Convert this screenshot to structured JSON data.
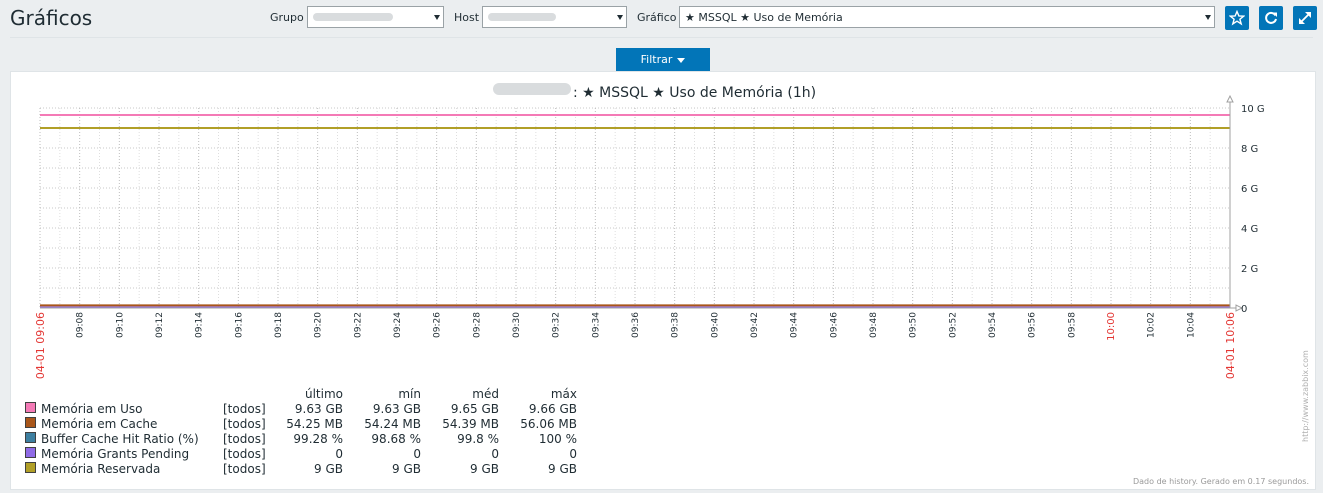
{
  "header": {
    "title": "Gráficos",
    "group_label": "Grupo",
    "host_label": "Host",
    "graph_label": "Gráfico",
    "graph_value": "★ MSSQL ★ Uso de Memória"
  },
  "toolbar": {
    "favorite_icon": "star-icon",
    "refresh_icon": "refresh-icon",
    "fullscreen_icon": "fullscreen-icon"
  },
  "filter": {
    "label": "Filtrar"
  },
  "colors": {
    "accent": "#0275b8"
  },
  "chart_data": {
    "type": "line",
    "title": ": ★ MSSQL ★ Uso de Memória (1h)",
    "y_ticks": [
      "10 G",
      "8 G",
      "6 G",
      "4 G",
      "2 G",
      "0"
    ],
    "ylim": [
      0,
      10
    ],
    "y_unit": "G",
    "x_start_label": "04-01 09:06",
    "x_end_label": "04-01 10:06",
    "x_ticks": [
      "09:08",
      "09:10",
      "09:12",
      "09:14",
      "09:16",
      "09:18",
      "09:20",
      "09:22",
      "09:24",
      "09:26",
      "09:28",
      "09:30",
      "09:32",
      "09:34",
      "09:36",
      "09:38",
      "09:40",
      "09:42",
      "09:44",
      "09:46",
      "09:48",
      "09:50",
      "09:52",
      "09:54",
      "09:56",
      "09:58",
      "10:00",
      "10:02",
      "10:04"
    ],
    "x_red_ticks": [
      "10:00"
    ],
    "grid": true,
    "legend_headers": {
      "last": "último",
      "min": "mín",
      "avg": "méd",
      "max": "máx"
    },
    "series": [
      {
        "name": "Memória em Uso",
        "color": "#f47ab6",
        "func": "[todos]",
        "last": "9.63 GB",
        "min": "9.63 GB",
        "avg": "9.65 GB",
        "max": "9.66 GB",
        "value": 9.65
      },
      {
        "name": "Memória em Cache",
        "color": "#a9561a",
        "func": "[todos]",
        "last": "54.25 MB",
        "min": "54.24 MB",
        "avg": "54.39 MB",
        "max": "56.06 MB",
        "value": 0.054
      },
      {
        "name": "Buffer Cache Hit Ratio (%)",
        "color": "#3d7fa0",
        "func": "[todos]",
        "last": "99.28 %",
        "min": "98.68 %",
        "avg": "99.8 %",
        "max": "100 %",
        "value": 0.0001
      },
      {
        "name": "Memória Grants Pending",
        "color": "#8f6ae6",
        "func": "[todos]",
        "last": "0",
        "min": "0",
        "avg": "0",
        "max": "0",
        "value": 0
      },
      {
        "name": "Memória Reservada",
        "color": "#b19f27",
        "func": "[todos]",
        "last": "9 GB",
        "min": "9 GB",
        "avg": "9 GB",
        "max": "9 GB",
        "value": 9
      }
    ],
    "watermark": "http://www.zabbix.com",
    "footer_note": "Dado de history. Gerado em 0.17 segundos."
  }
}
